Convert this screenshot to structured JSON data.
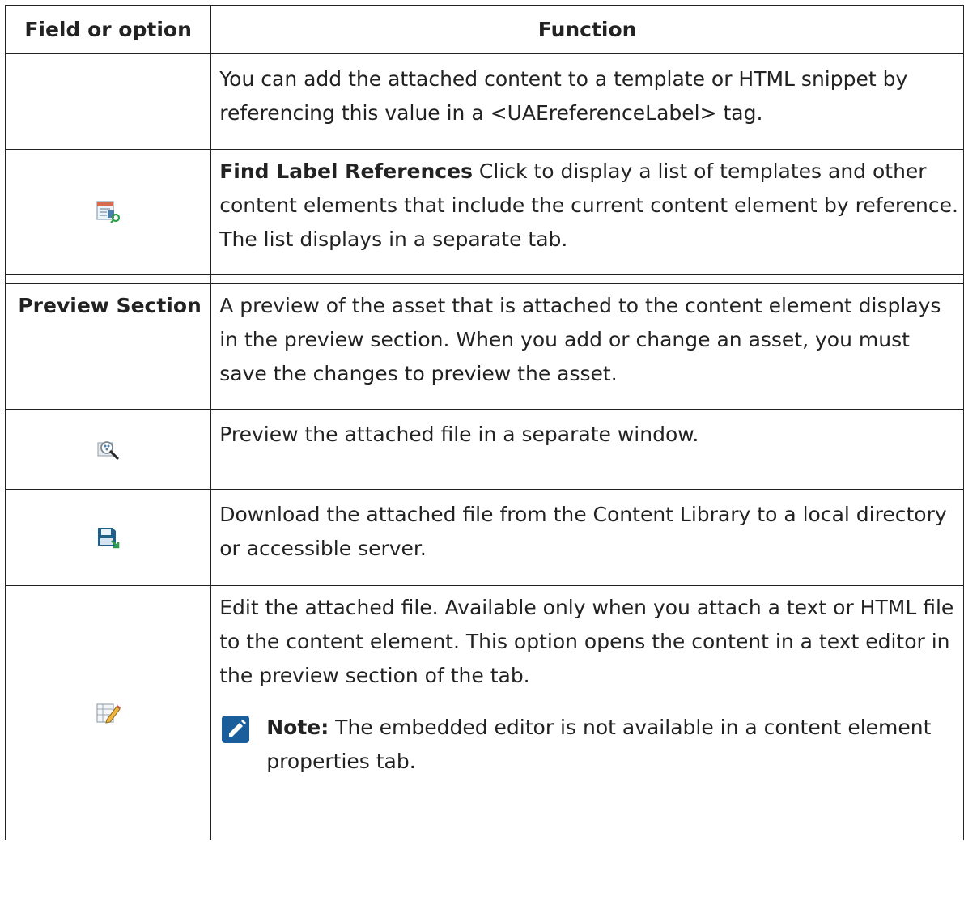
{
  "header": {
    "col1": "Field or option",
    "col2": "Function"
  },
  "rows": {
    "r1": {
      "function": "You can add the attached content to a template or HTML snippet by referencing this value in a <UAEreferenceLabel> tag."
    },
    "r2": {
      "icon": "find-label-references-icon",
      "bold": "Find Label References",
      "function": " Click to display a list of templates and other content elements that include the current content element by reference. The list displays in a separate tab."
    },
    "r3": {
      "field": "Preview Section",
      "function": "A preview of the asset that is attached to the content element displays in the preview section. When you add or change an asset, you must save the changes to preview the asset."
    },
    "r4": {
      "icon": "preview-magnifier-icon",
      "function": "Preview the attached file in a separate window."
    },
    "r5": {
      "icon": "download-save-icon",
      "function": "Download the attached file from the Content Library to a local directory or accessible server."
    },
    "r6": {
      "icon": "edit-file-icon",
      "function": "Edit the attached file. Available only when you attach a text or HTML file to the content element. This option opens the content in a text editor in the preview section of the tab.",
      "note_icon": "pencil-note-icon",
      "note_label": "Note:",
      "note_text": " The embedded editor is not available in a content element properties tab."
    }
  },
  "colors": {
    "note_icon_bg": "#1b5e9c",
    "save_icon": "#1f5f8b",
    "save_arrow": "#2e9e46"
  }
}
